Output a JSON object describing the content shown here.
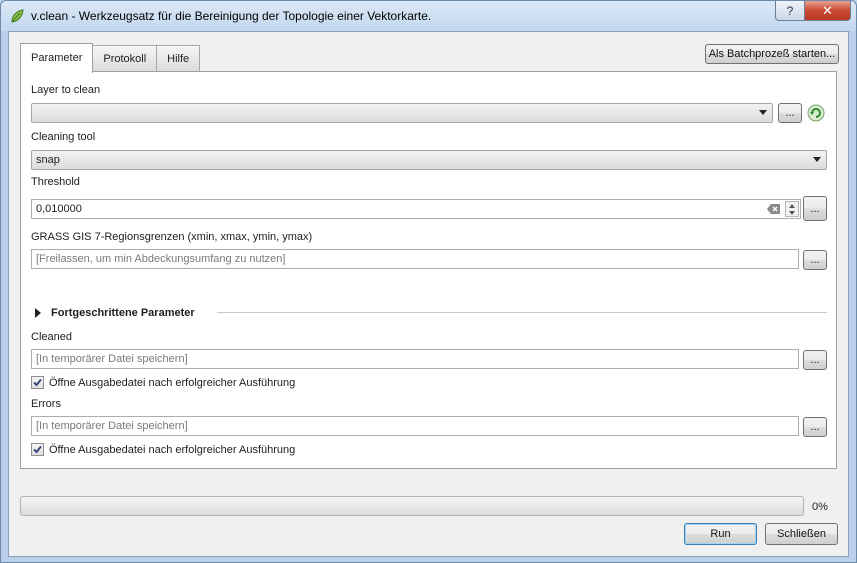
{
  "window": {
    "title": "v.clean - Werkzeugsatz für die Bereinigung der Topologie einer Vektorkarte.",
    "help_label": "?",
    "close_label": "✕"
  },
  "tabs": [
    {
      "label": "Parameter",
      "active": true
    },
    {
      "label": "Protokoll",
      "active": false
    },
    {
      "label": "Hilfe",
      "active": false
    }
  ],
  "batch_button": "Als Batchprozeß starten...",
  "params": {
    "layer": {
      "label": "Layer to clean",
      "value": "",
      "browse": "..."
    },
    "tool": {
      "label": "Cleaning tool",
      "value": "snap"
    },
    "threshold": {
      "label": "Threshold",
      "value": "0,010000",
      "browse": "..."
    },
    "region": {
      "label": "GRASS GIS 7-Regionsgrenzen (xmin, xmax, ymin, ymax)",
      "placeholder": "[Freilassen, um min Abdeckungsumfang zu nutzen]",
      "browse": "..."
    },
    "advanced_label": "Fortgeschrittene Parameter",
    "cleaned": {
      "label": "Cleaned",
      "placeholder": "[In temporärer Datei speichern]",
      "browse": "...",
      "open_label": "Öffne Ausgabedatei nach erfolgreicher Ausführung",
      "open_checked": true
    },
    "errors": {
      "label": "Errors",
      "placeholder": "[In temporärer Datei speichern]",
      "browse": "...",
      "open_label": "Öffne Ausgabedatei nach erfolgreicher Ausführung",
      "open_checked": true
    }
  },
  "progress": {
    "value": 0,
    "label": "0%"
  },
  "buttons": {
    "run": "Run",
    "close": "Schließen"
  },
  "colors": {
    "accent": "#3c7fb1",
    "title_bar": "#c3d7ee"
  },
  "icons": [
    "qgis-leaf-icon",
    "refresh-layers-icon",
    "clear-field-icon",
    "spin-arrows-icon"
  ]
}
